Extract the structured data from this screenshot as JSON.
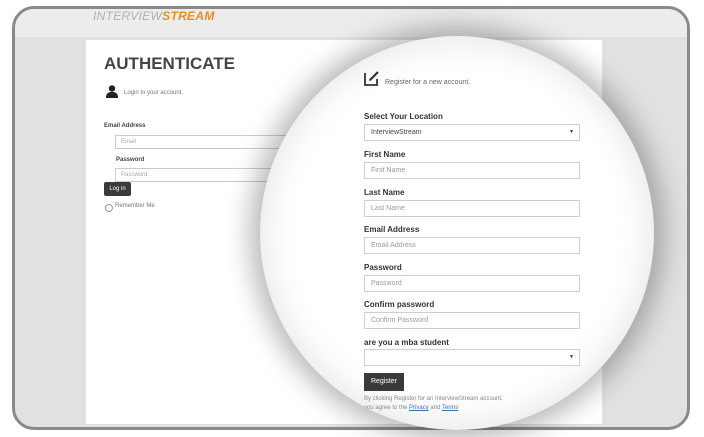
{
  "logo": {
    "part1": "INTERVIEW",
    "part2": "STREAM"
  },
  "auth": {
    "title": "AUTHENTICATE",
    "login_caption": "Login to your account.",
    "email_label": "Email Address",
    "email_placeholder": "Email",
    "password_label": "Password",
    "password_placeholder": "Password",
    "login_button": "Log in",
    "remember_label": "Remember Me"
  },
  "register": {
    "caption": "Register for a new account.",
    "location_label": "Select Your Location",
    "location_value": "InterviewStream",
    "first_name_label": "First Name",
    "first_name_placeholder": "First Name",
    "last_name_label": "Last Name",
    "last_name_placeholder": "Last Name",
    "email_label": "Email Address",
    "email_placeholder": "Email Address",
    "password_label": "Password",
    "password_placeholder": "Password",
    "confirm_label": "Confirm password",
    "confirm_placeholder": "Confirm Password",
    "mba_label": "are you a mba student",
    "mba_value": "",
    "register_button": "Register",
    "terms_line1": "By clicking Register for an InterviewStream account,",
    "terms_prefix": "you agree to the",
    "privacy_link": "Privacy",
    "terms_and": "and",
    "terms_link": "Terms"
  }
}
